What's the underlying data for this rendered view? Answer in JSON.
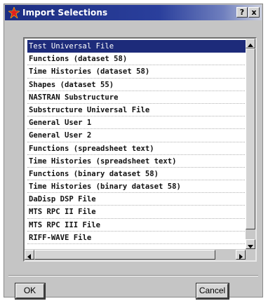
{
  "window": {
    "title": "Import Selections",
    "help_label": "?",
    "close_label": "x"
  },
  "list": {
    "items": [
      {
        "label": "Test Universal File",
        "selected": true
      },
      {
        "label": "Functions (dataset 58)",
        "selected": false
      },
      {
        "label": "Time Histories (dataset 58)",
        "selected": false
      },
      {
        "label": "Shapes (dataset 55)",
        "selected": false
      },
      {
        "label": "NASTRAN Substructure",
        "selected": false
      },
      {
        "label": "Substructure Universal File",
        "selected": false
      },
      {
        "label": "General User 1",
        "selected": false
      },
      {
        "label": "General User 2",
        "selected": false
      },
      {
        "label": "Functions (spreadsheet text)",
        "selected": false
      },
      {
        "label": "Time Histories (spreadsheet text)",
        "selected": false
      },
      {
        "label": "Functions (binary dataset 58)",
        "selected": false
      },
      {
        "label": "Time Histories (binary dataset 58)",
        "selected": false
      },
      {
        "label": "DaDisp DSP File",
        "selected": false
      },
      {
        "label": "MTS RPC II File",
        "selected": false
      },
      {
        "label": "MTS RPC III File",
        "selected": false
      },
      {
        "label": "RIFF-WAVE File",
        "selected": false
      }
    ]
  },
  "buttons": {
    "ok_label": "OK",
    "cancel_label": "Cancel"
  },
  "colors": {
    "selection": "#1d2b7a",
    "titlebar": "#1d2e82",
    "dialog_bg": "#c5c5c5"
  },
  "icons": {
    "app": "red-star-icon",
    "scroll_up": "arrow-up-icon",
    "scroll_down": "arrow-down-icon",
    "scroll_left": "arrow-left-icon",
    "scroll_right": "arrow-right-icon"
  }
}
